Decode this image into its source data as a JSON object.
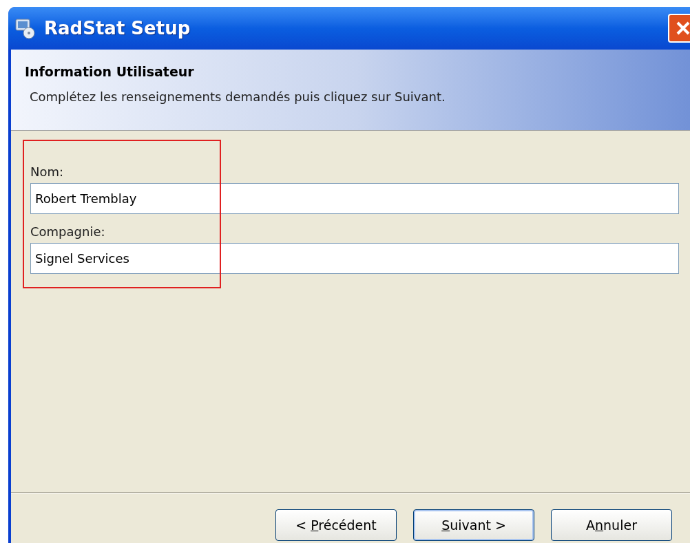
{
  "window": {
    "title": "RadStat Setup"
  },
  "header": {
    "title": "Information Utilisateur",
    "subtitle": "Complétez les renseignements demandés puis cliquez sur Suivant."
  },
  "fields": [
    {
      "label": "Nom:",
      "value": "Robert Tremblay"
    },
    {
      "label": "Compagnie:",
      "value": "Signel Services"
    }
  ],
  "annotation_box": {
    "shown": true
  },
  "buttons": [
    {
      "before": "< ",
      "mnemonic": "P",
      "after": "récédent",
      "default": false
    },
    {
      "mnemonic": "S",
      "after": "uivant >",
      "default": true
    },
    {
      "before": "A",
      "mnemonic": "n",
      "after": "nuler",
      "default": false
    }
  ]
}
